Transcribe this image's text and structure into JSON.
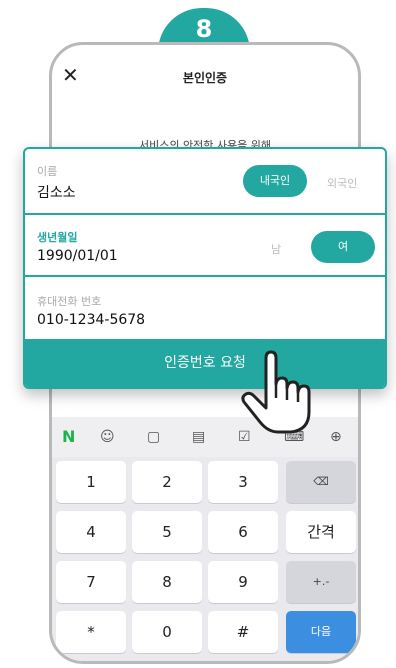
{
  "step": "8",
  "header": {
    "title": "본인인증",
    "close_icon": "close-icon"
  },
  "subtitle": "서비스의 안전한 사용을 위해",
  "form": {
    "name_label": "이름",
    "name_value": "김소소",
    "nationality": {
      "domestic": "내국인",
      "foreign": "외국인",
      "selected": "내국인"
    },
    "birth_label": "생년월일",
    "birth_value": "1990/01/01",
    "gender": {
      "male": "남",
      "female": "여",
      "selected": "여"
    },
    "phone_label": "휴대전화 번호",
    "phone_value": "010-1234-5678",
    "submit_label": "인증번호 요청"
  },
  "keyboard": {
    "toolbar": [
      "naver-icon",
      "emoji-icon",
      "emoticon-icon",
      "clipboard-icon",
      "checklist-icon",
      "keyboard-icon",
      "add-icon"
    ],
    "naver_glyph": "N",
    "keys": {
      "k1": "1",
      "k2": "2",
      "k3": "3",
      "k4": "4",
      "k5": "5",
      "k6": "6",
      "k7": "7",
      "k8": "8",
      "k9": "9",
      "star": "*",
      "k0": "0",
      "hash": "#",
      "space": "간격",
      "plusminus": "+.-",
      "next": "다음"
    }
  },
  "colors": {
    "accent": "#22a8a0",
    "next_key": "#3b8ee0"
  }
}
